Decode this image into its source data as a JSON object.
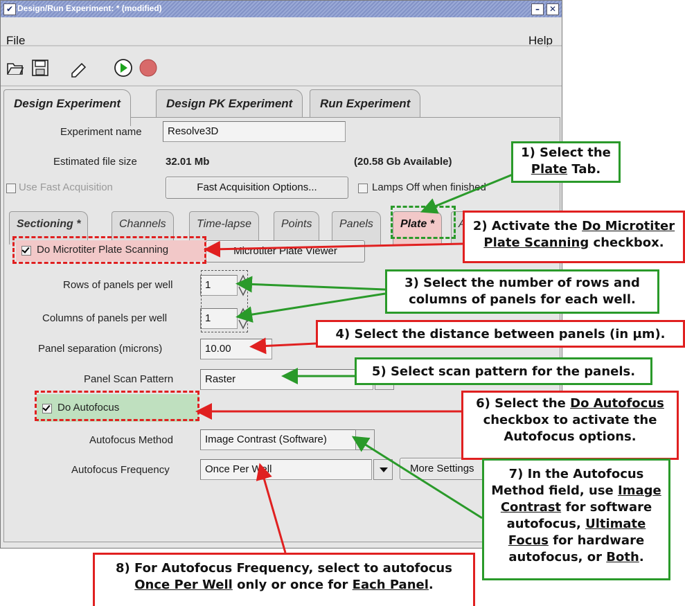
{
  "window": {
    "title": "Design/Run Experiment: * (modified)",
    "menu": {
      "file": "File",
      "help": "Help"
    }
  },
  "icons": [
    "open-icon",
    "save-icon",
    "edit-icon",
    "run-icon",
    "stop-icon"
  ],
  "main_tabs": [
    "Design Experiment",
    "Design PK Experiment",
    "Run Experiment"
  ],
  "experiment": {
    "name_label": "Experiment name",
    "name_value": "Resolve3D",
    "file_size_label": "Estimated file size",
    "file_size_value": "32.01 Mb",
    "available": "(20.58 Gb Available)",
    "fast_acq_label": "Use Fast Acquisition",
    "fast_acq_button": "Fast Acquisition Options...",
    "lamps_off_label": "Lamps Off when finished"
  },
  "sub_tabs": [
    "Sectioning *",
    "Channels",
    "Time-lapse",
    "Points",
    "Panels",
    "Plate *",
    "A"
  ],
  "plate": {
    "microtiter_label": "Do Microtiter Plate Scanning",
    "viewer_button": "Microtiter Plate Viewer",
    "rows_label": "Rows of panels per well",
    "rows_value": "1",
    "cols_label": "Columns of panels per well",
    "cols_value": "1",
    "sep_label": "Panel separation (microns)",
    "sep_value": "10.00",
    "pattern_label": "Panel Scan Pattern",
    "pattern_value": "Raster",
    "autofocus_label": "Do Autofocus",
    "af_method_label": "Autofocus Method",
    "af_method_value": "Image Contrast (Software)",
    "af_freq_label": "Autofocus Frequency",
    "af_freq_value": "Once Per Well",
    "more_settings": "More Settings"
  },
  "annotations": {
    "step1": [
      "1) Select the",
      "Plate",
      "Tab."
    ],
    "step2": [
      "2) Activate the",
      "Do Microtiter",
      "Plate Scanning",
      "checkbox."
    ],
    "step3": [
      "3) Select the number of rows and",
      "columns of panels for each well."
    ],
    "step4": "4) Select the distance between panels (in μm).",
    "step5": "5) Select scan pattern for the panels.",
    "step6": [
      "6) Select the",
      "Do Autofocus",
      "checkbox to activate the",
      "Autofocus options."
    ],
    "step7": [
      "7) In the Autofocus",
      "Method field, use",
      "Image",
      "Contrast",
      "for software",
      "autofocus,",
      "Ultimate",
      "Focus",
      "for hardware",
      "autofocus, or",
      "Both",
      "."
    ],
    "step8": [
      "8) For Autofocus Frequency, select to autofocus",
      "Once Per Well",
      "only or once for",
      "Each Panel",
      "."
    ]
  },
  "colors": {
    "red": "#e02020",
    "green": "#2a9a2a",
    "title_bar": "#8a99cc"
  }
}
